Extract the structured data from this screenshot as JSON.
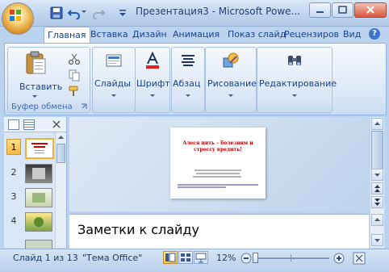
{
  "window": {
    "title": "Презентация3 - Microsoft Powe...",
    "controls": {
      "minimize": "–",
      "maximize": "□",
      "close": "✕"
    }
  },
  "quick_access": {
    "save_icon": "save-icon",
    "undo_icon": "undo-icon",
    "redo_icon": "redo-icon",
    "customize_icon": "chevron-down-icon"
  },
  "tabs": [
    "Главная",
    "Вставка",
    "Дизайн",
    "Анимация",
    "Показ слайд",
    "Рецензиров",
    "Вид"
  ],
  "active_tab": "Главная",
  "ribbon": {
    "groups": {
      "clipboard": {
        "label": "Буфер обмена",
        "paste_label": "Вставить"
      },
      "slides": {
        "label": "Слайды"
      },
      "font": {
        "label": "Шрифт"
      },
      "paragraph": {
        "label": "Абзац"
      },
      "drawing": {
        "label": "Рисование"
      },
      "editing": {
        "label": "Редактирование"
      }
    }
  },
  "slides_panel": {
    "numbers": [
      "1",
      "2",
      "3",
      "4"
    ],
    "selected": "1"
  },
  "slide": {
    "title": "Алеся пить – болезням и стрессу вредить!"
  },
  "notes": {
    "placeholder": "Заметки к слайду"
  },
  "status": {
    "slide_counter": "Слайд 1 из 13",
    "theme": "\"Тема Office\"",
    "zoom": "12%"
  },
  "colors": {
    "accent": "#15428b",
    "ribbon_bg": "#dbe8f7",
    "slide_title": "#c00000"
  }
}
